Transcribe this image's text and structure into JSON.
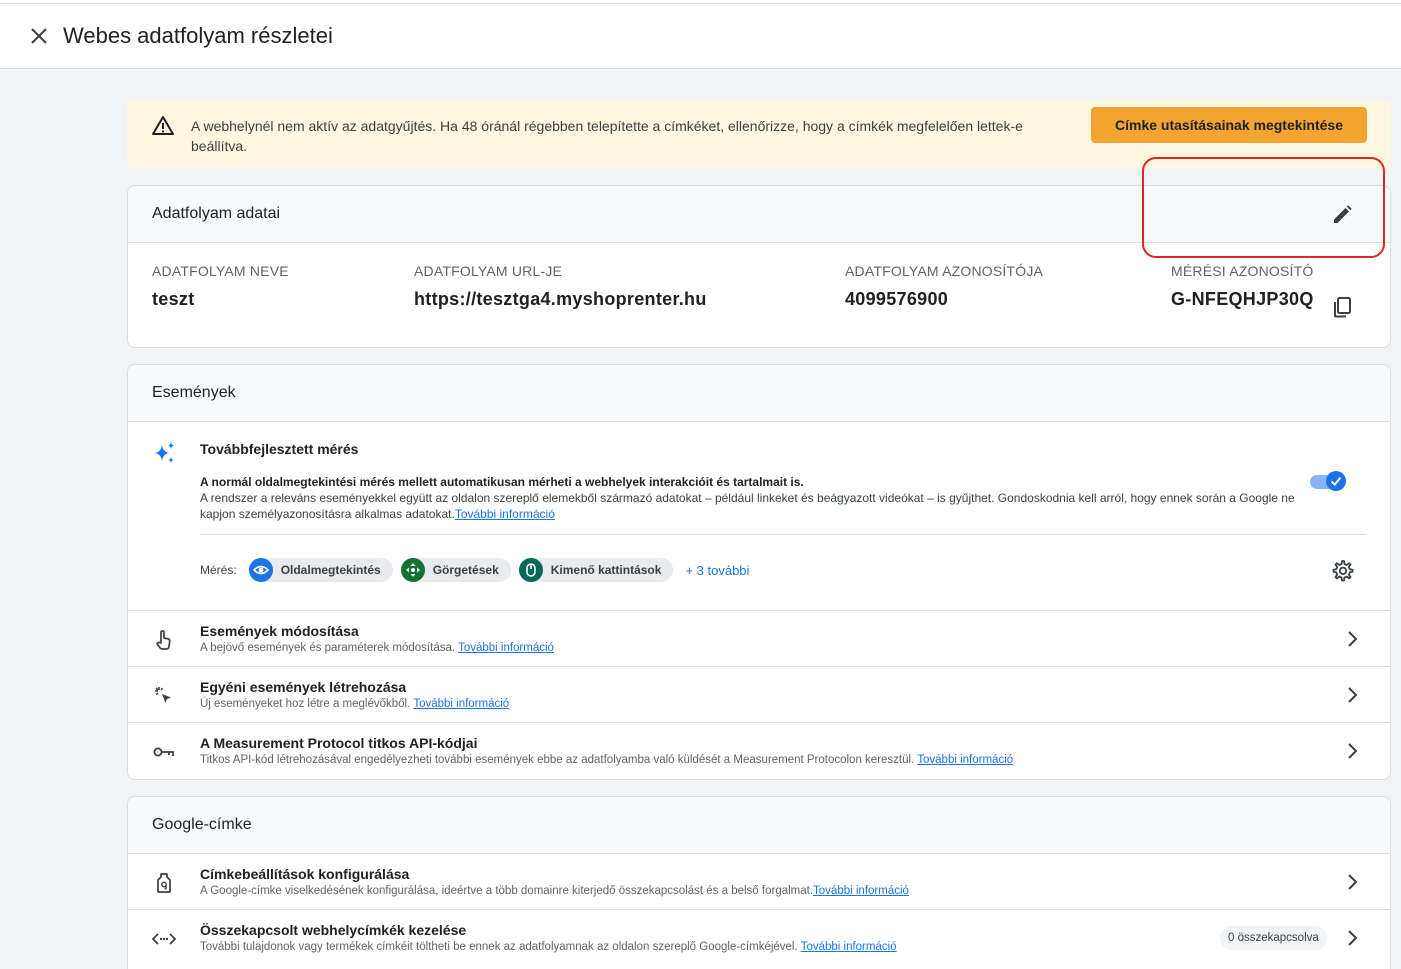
{
  "header": {
    "title": "Webes adatfolyam részletei"
  },
  "alert": {
    "text": "A webhelynél nem aktív az adatgyűjtés. Ha 48 óránál régebben telepítette a címkéket, ellenőrizze, hogy a címkék megfelelően lettek-e beállítva.",
    "button_label": "Címke utasításainak megtekintése"
  },
  "stream_details": {
    "title": "Adatfolyam adatai",
    "name_label": "ADATFOLYAM NEVE",
    "name_value": "teszt",
    "url_label": "ADATFOLYAM URL-JE",
    "url_value": "https://tesztga4.myshoprenter.hu",
    "id_label": "ADATFOLYAM AZONOSÍTÓJA",
    "id_value": "4099576900",
    "measurement_label": "MÉRÉSI AZONOSÍTÓ",
    "measurement_value": "G-NFEQHJP30Q"
  },
  "events": {
    "title": "Események",
    "enhanced": {
      "title": "Továbbfejlesztett mérés",
      "desc_bold": "A normál oldalmegtekintési mérés mellett automatikusan mérheti a webhelyek interakcióit és tartalmait is.",
      "desc": "A rendszer a releváns eseményekkel együtt az oldalon szereplő elemekből származó adatokat – például linkeket és beágyazott videókat – is gyűjthet. Gondoskodnia kell arról, hogy ennek során a Google ne kapjon személyazonosításra alkalmas adatokat.",
      "link": "További információ",
      "enabled": true,
      "measure_label": "Mérés:",
      "chips": [
        "Oldalmegtekintés",
        "Görgetések",
        "Kimenő kattintások"
      ],
      "more": "+ 3 további"
    },
    "rows": [
      {
        "title": "Események módosítása",
        "desc": "A bejövő események és paraméterek módosítása.",
        "link": "További információ"
      },
      {
        "title": "Egyéni események létrehozása",
        "desc": "Új eseményeket hoz létre a meglévőkből.",
        "link": "További információ"
      },
      {
        "title": "A Measurement Protocol titkos API-kódjai",
        "desc": "Titkos API-kód létrehozásával engedélyezheti további események ebbe az adatfolyamba való küldését a Measurement Protocolon keresztül.",
        "link": "További információ"
      }
    ]
  },
  "google_tag": {
    "title": "Google-címke",
    "rows": [
      {
        "title": "Címkebeállítások konfigurálása",
        "desc": "A Google-címke viselkedésének konfigurálása, ideértve a több domainre kiterjedő összekapcsolást és a belső forgalmat.",
        "link": "További információ"
      },
      {
        "title": "Összekapcsolt webhelycímkék kezelése",
        "desc": "További tulajdonok vagy termékek címkéit töltheti be ennek az adatfolyamnak az oldalon szereplő Google-címkéjével.",
        "link": "További információ",
        "badge": "0 összekapcsolva"
      }
    ]
  },
  "colors": {
    "accent": "#1a73e8",
    "warning_bg": "#fef7e0",
    "warning_button": "#f4a531",
    "highlight": "#e0271e"
  }
}
